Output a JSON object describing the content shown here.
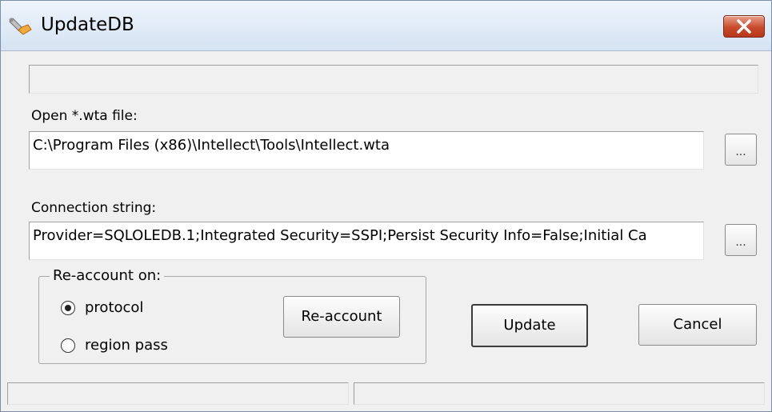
{
  "window": {
    "title": "UpdateDB"
  },
  "file": {
    "label": "Open *.wta file:",
    "value": "C:\\Program Files (x86)\\Intellect\\Tools\\Intellect.wta",
    "browse_label": "..."
  },
  "connection": {
    "label": "Connection string:",
    "value": "Provider=SQLOLEDB.1;Integrated Security=SSPI;Persist Security Info=False;Initial Ca",
    "browse_label": "..."
  },
  "reaccount": {
    "group_title": "Re-account on:",
    "options": [
      {
        "label": "protocol",
        "selected": true
      },
      {
        "label": "region pass",
        "selected": false
      }
    ],
    "button_label": "Re-account"
  },
  "actions": {
    "update_label": "Update",
    "cancel_label": "Cancel"
  },
  "status_bar": {
    "panes": [
      "",
      ""
    ]
  },
  "icons": {
    "app": "wrench-icon",
    "close": "close-icon"
  },
  "colors": {
    "close_button": "#c94a2b",
    "window_bg": "#f0f0f0"
  }
}
